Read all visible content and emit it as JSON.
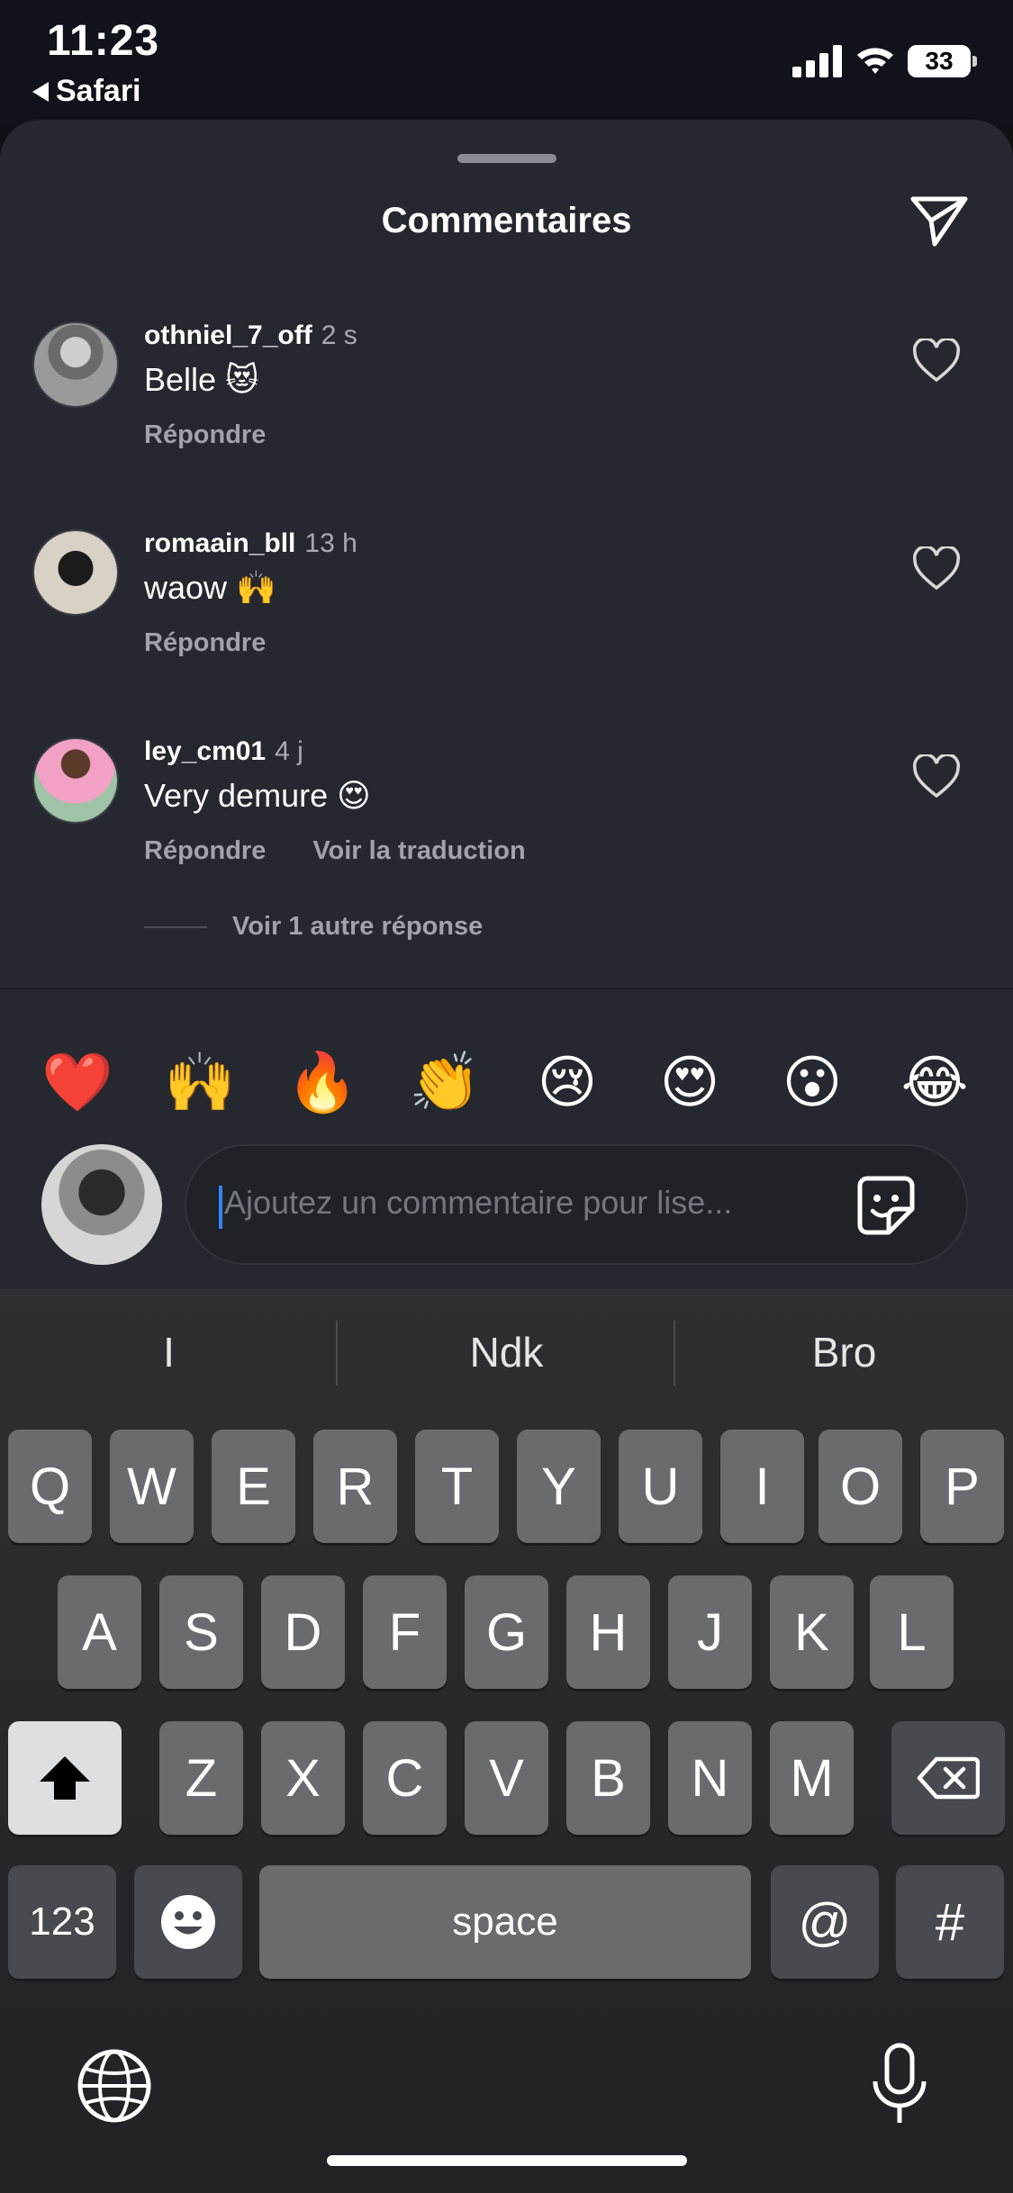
{
  "status": {
    "time": "11:23",
    "back_app": "Safari",
    "battery": "33"
  },
  "sheet": {
    "title": "Commentaires"
  },
  "comments": [
    {
      "user": "othniel_7_off",
      "time": "2 s",
      "text": "Belle 😻",
      "actions": [
        "Répondre"
      ]
    },
    {
      "user": "romaain_bll",
      "time": "13 h",
      "text": "waow 🙌",
      "actions": [
        "Répondre"
      ]
    },
    {
      "user": "ley_cm01",
      "time": "4 j",
      "text": "Very demure 😍",
      "actions": [
        "Répondre",
        "Voir la traduction"
      ]
    }
  ],
  "replies_link": "Voir 1 autre réponse",
  "quick_emojis": [
    "❤️",
    "🙌",
    "🔥",
    "👏",
    "😢",
    "😍",
    "😮",
    "😂"
  ],
  "composer": {
    "placeholder": "Ajoutez un commentaire pour lise..."
  },
  "keyboard": {
    "suggestions": [
      "I",
      "Ndk",
      "Bro"
    ],
    "row1": [
      "Q",
      "W",
      "E",
      "R",
      "T",
      "Y",
      "U",
      "I",
      "O",
      "P"
    ],
    "row2": [
      "A",
      "S",
      "D",
      "F",
      "G",
      "H",
      "J",
      "K",
      "L"
    ],
    "row3": [
      "Z",
      "X",
      "C",
      "V",
      "B",
      "N",
      "M"
    ],
    "numbers_label": "123",
    "space_label": "space",
    "at_label": "@",
    "hash_label": "#"
  }
}
